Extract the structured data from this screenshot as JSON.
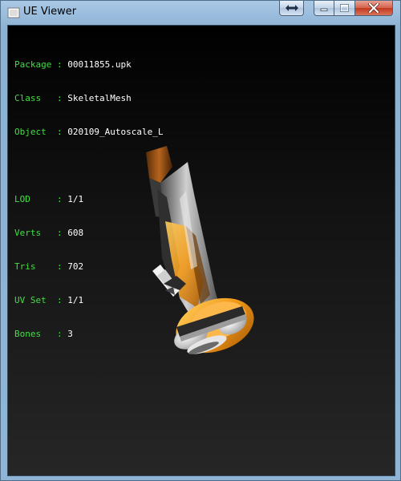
{
  "window": {
    "title": "UE Viewer"
  },
  "titlebar": {
    "buttons": [
      {
        "name": "restore-alt",
        "icon": "double-arrow-icon"
      },
      {
        "name": "minimize",
        "icon": "minimize-icon"
      },
      {
        "name": "maximize",
        "icon": "maximize-icon"
      },
      {
        "name": "close",
        "icon": "close-icon"
      }
    ]
  },
  "info": {
    "group1": [
      {
        "label": "Package",
        "sep": " : ",
        "value": "00011855.upk"
      },
      {
        "label": "Class  ",
        "sep": " : ",
        "value": "SkeletalMesh"
      },
      {
        "label": "Object ",
        "sep": " : ",
        "value": "020109_Autoscale_L"
      }
    ],
    "group2": [
      {
        "label": "LOD    ",
        "sep": " : ",
        "value": "1/1"
      },
      {
        "label": "Verts  ",
        "sep": " : ",
        "value": "608"
      },
      {
        "label": "Tris   ",
        "sep": " : ",
        "value": "702"
      },
      {
        "label": "UV Set ",
        "sep": " : ",
        "value": "1/1"
      },
      {
        "label": "Bones  ",
        "sep": " : ",
        "value": "3"
      }
    ]
  },
  "colors": {
    "label": "#3fe03f",
    "value": "#ffffff",
    "accent_orange": "#f29a1a"
  }
}
